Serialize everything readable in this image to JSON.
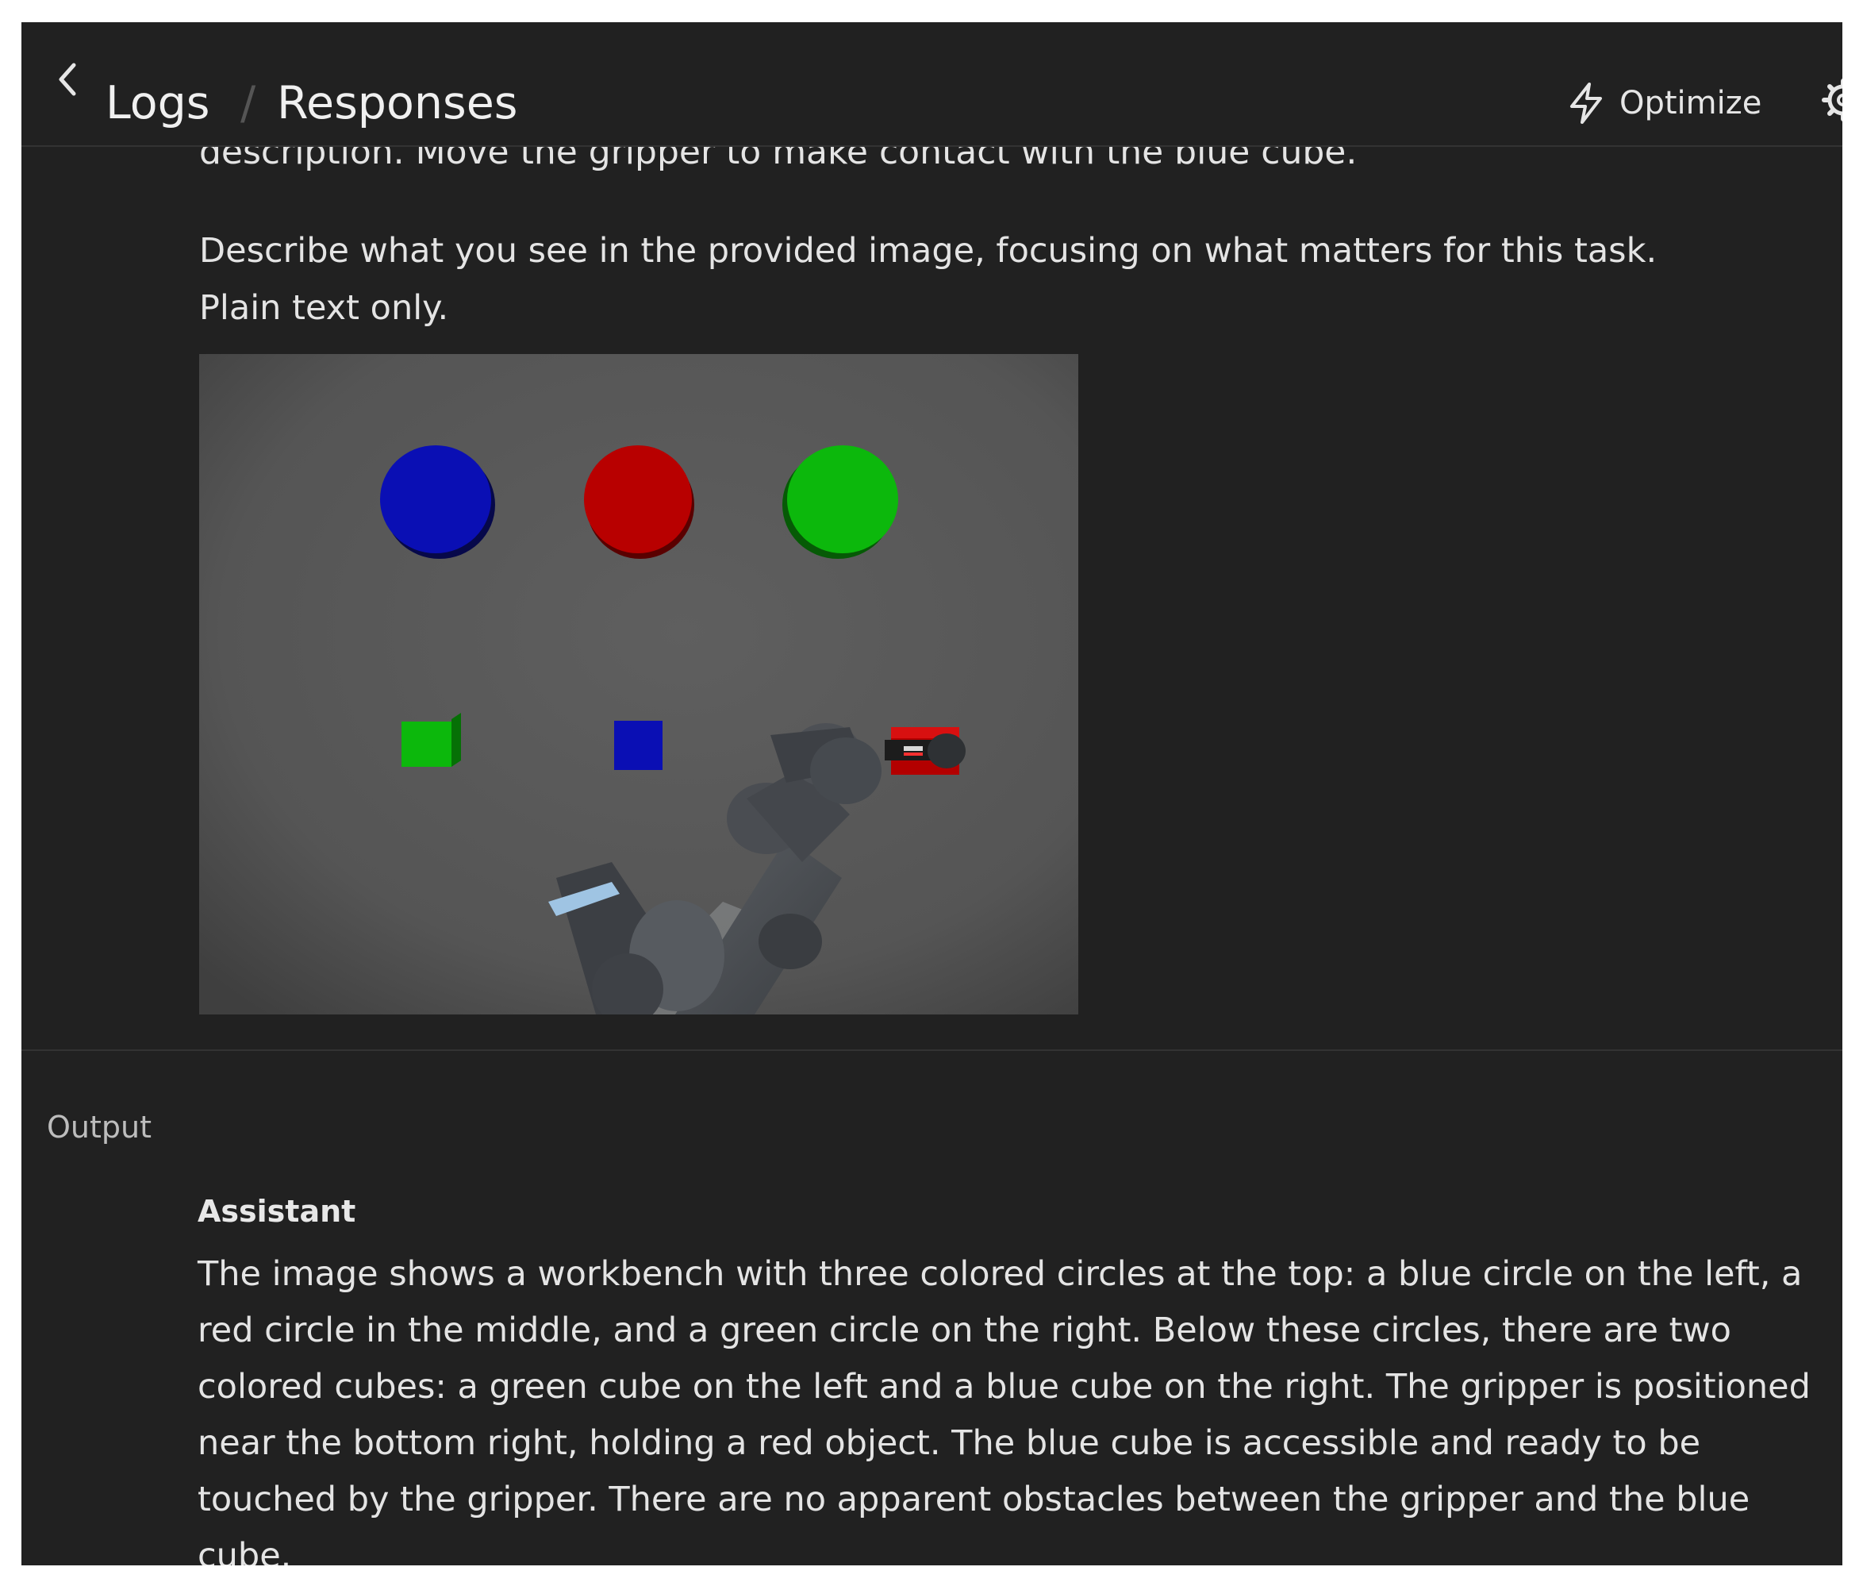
{
  "header": {
    "breadcrumb": [
      "Logs",
      "Responses"
    ],
    "separator": "/",
    "optimize_label": "Optimize",
    "icons": [
      "chevron-left-icon",
      "lightning-icon",
      "gear-icon"
    ]
  },
  "input": {
    "clipped_line": "description. Move the gripper to make contact with the blue cube.",
    "prompt_line_1": "Describe what you see in the provided image, focusing on what matters for this task.",
    "prompt_line_2": "Plain text only."
  },
  "scene_colors": {
    "blue": "#0a0fb4",
    "red": "#b80000",
    "green": "#0cb80c",
    "background": "#5a5a5a"
  },
  "output": {
    "section_label": "Output",
    "role": "Assistant",
    "text": "The image shows a workbench with three colored circles at the top: a blue circle on the left, a red circle in the middle, and a green circle on the right. Below these circles, there are two colored cubes: a green cube on the left and a blue cube on the right. The gripper is positioned near the bottom right, holding a red object. The blue cube is accessible and ready to be touched by the gripper. There are no apparent obstacles between the gripper and the blue cube."
  }
}
